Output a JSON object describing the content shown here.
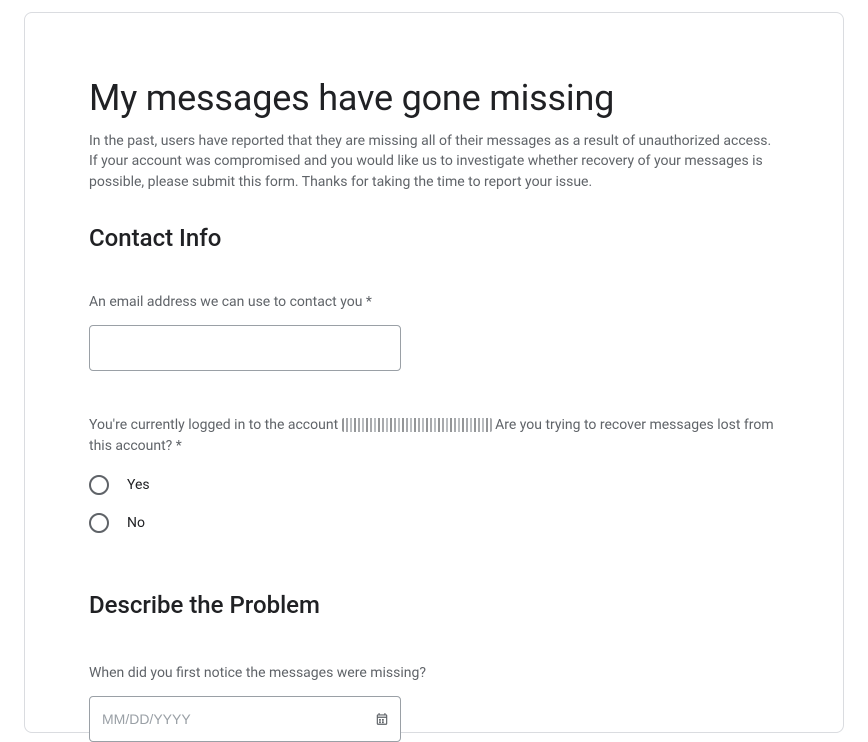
{
  "header": {
    "title": "My messages have gone missing",
    "intro": "In the past, users have reported that they are missing all of their messages as a result of unauthorized access. If your account was compromised and you would like us to investigate whether recovery of your messages is possible, please submit this form. Thanks for taking the time to report your issue."
  },
  "contact": {
    "section_title": "Contact Info",
    "email_label": "An email address we can use to contact you *",
    "email_value": "",
    "account_question_prefix": "You're currently logged in to the account ",
    "account_question_suffix": " Are you trying to recover messages lost from this account? *",
    "radio_yes": "Yes",
    "radio_no": "No"
  },
  "describe": {
    "section_title": "Describe the Problem",
    "date_label": "When did you first notice the messages were missing?",
    "date_placeholder": "MM/DD/YYYY",
    "date_value": ""
  }
}
